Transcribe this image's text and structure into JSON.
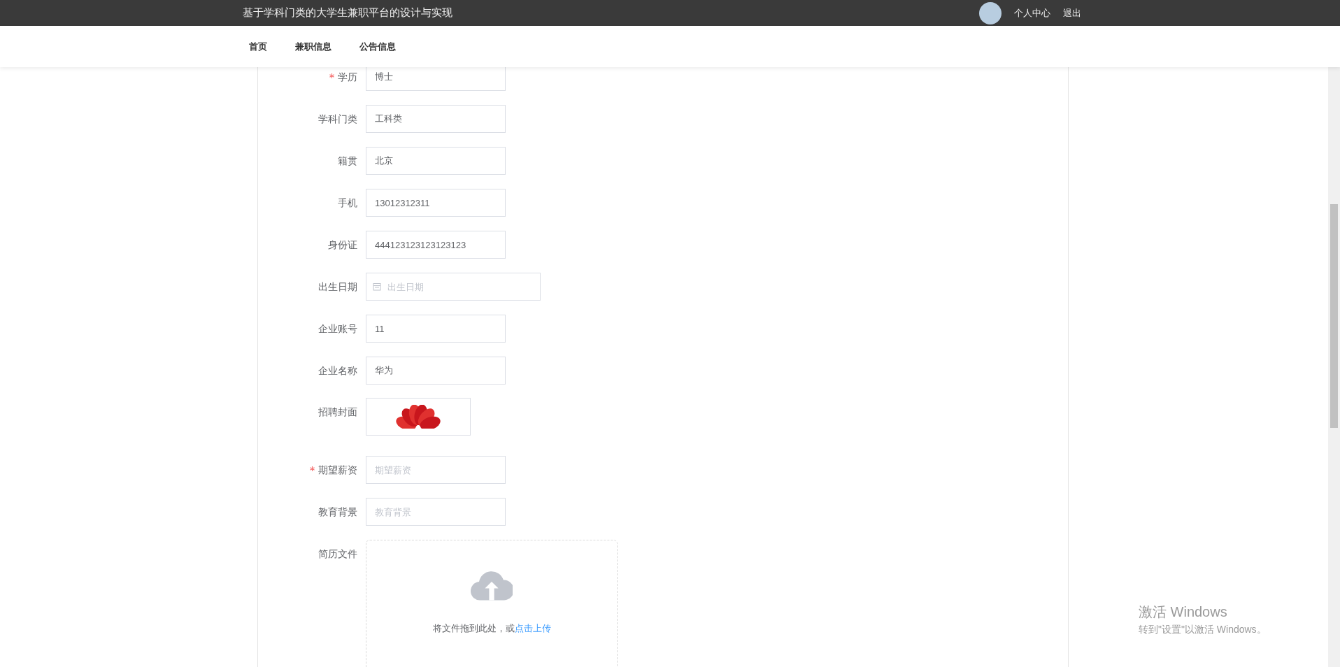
{
  "header": {
    "title": "基于学科门类的大学生兼职平台的设计与实现",
    "links": [
      "个人中心",
      "退出"
    ]
  },
  "nav": {
    "items": [
      {
        "label": "首页",
        "selected": false
      },
      {
        "label": "兼职信息",
        "selected": false
      },
      {
        "label": "公告信息",
        "selected": false
      }
    ]
  },
  "form": {
    "fields": [
      {
        "kind": "text",
        "label": "学历",
        "required": true,
        "value": "博士"
      },
      {
        "kind": "text",
        "label": "学科门类",
        "required": false,
        "value": "工科类"
      },
      {
        "kind": "text",
        "label": "籍贯",
        "required": false,
        "value": "北京"
      },
      {
        "kind": "text",
        "label": "手机",
        "required": false,
        "value": "13012312311"
      },
      {
        "kind": "text",
        "label": "身份证",
        "required": false,
        "value": "444123123123123123"
      },
      {
        "kind": "date",
        "label": "出生日期",
        "required": false,
        "placeholder": "出生日期"
      },
      {
        "kind": "text",
        "label": "企业账号",
        "required": false,
        "value": "11"
      },
      {
        "kind": "text",
        "label": "企业名称",
        "required": false,
        "value": "华为"
      },
      {
        "kind": "image",
        "label": "招聘封面",
        "required": false
      },
      {
        "kind": "text",
        "label": "期望薪资",
        "required": true,
        "placeholder": "期望薪资"
      },
      {
        "kind": "text",
        "label": "教育背景",
        "required": false,
        "placeholder": "教育背景"
      },
      {
        "kind": "upload",
        "label": "简历文件",
        "required": false,
        "hint": "将文件拖到此处，或",
        "link": "点击上传"
      }
    ]
  },
  "windows_activation": {
    "title": "激活 Windows",
    "subtitle": "转到\"设置\"以激活 Windows。"
  }
}
